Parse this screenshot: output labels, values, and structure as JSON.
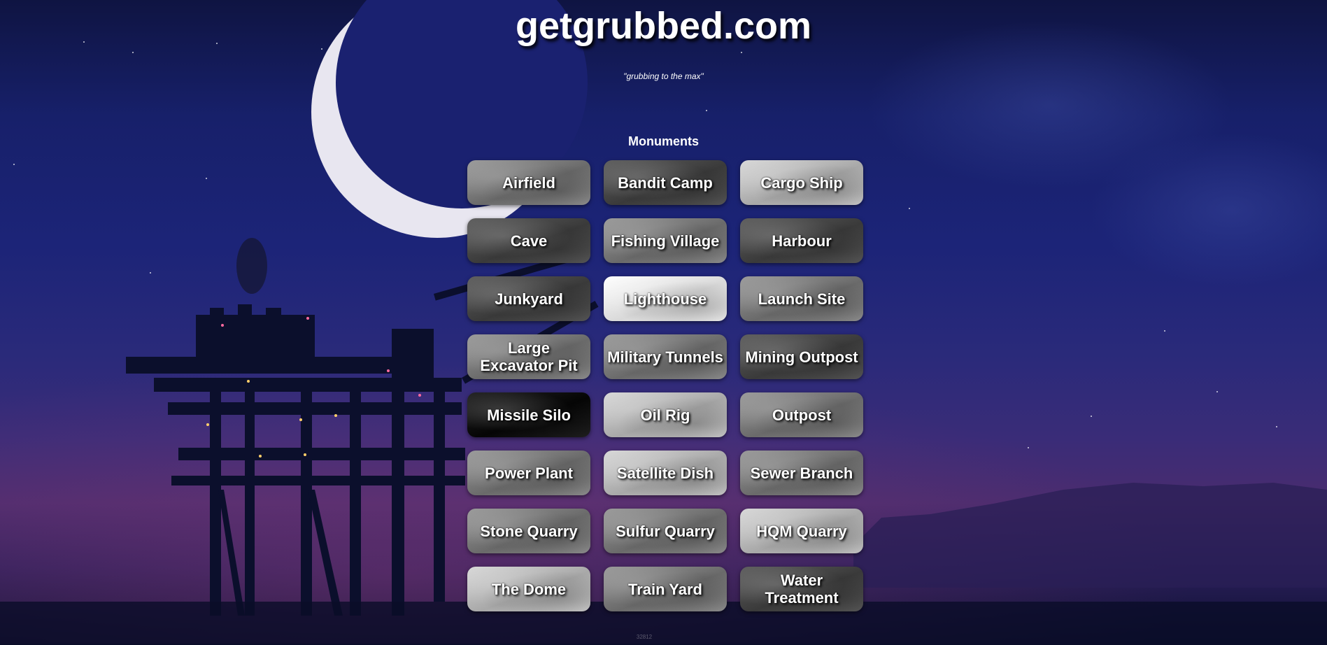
{
  "header": {
    "site_title": "getgrubbed.com",
    "tagline": "\"grubbing to the max\""
  },
  "section": {
    "title": "Monuments"
  },
  "monuments": [
    {
      "label": "Airfield",
      "tone": "mid"
    },
    {
      "label": "Bandit Camp",
      "tone": "dark"
    },
    {
      "label": "Cargo Ship",
      "tone": "light"
    },
    {
      "label": "Cave",
      "tone": "dark"
    },
    {
      "label": "Fishing Village",
      "tone": "mid"
    },
    {
      "label": "Harbour",
      "tone": "dark"
    },
    {
      "label": "Junkyard",
      "tone": "dark"
    },
    {
      "label": "Lighthouse",
      "tone": "bright"
    },
    {
      "label": "Launch Site",
      "tone": "mid"
    },
    {
      "label": "Large Excavator Pit",
      "tone": "mid"
    },
    {
      "label": "Military Tunnels",
      "tone": "mid"
    },
    {
      "label": "Mining Outpost",
      "tone": "dark"
    },
    {
      "label": "Missile Silo",
      "tone": "black"
    },
    {
      "label": "Oil Rig",
      "tone": "light"
    },
    {
      "label": "Outpost",
      "tone": "mid"
    },
    {
      "label": "Power Plant",
      "tone": "mid"
    },
    {
      "label": "Satellite Dish",
      "tone": "light"
    },
    {
      "label": "Sewer Branch",
      "tone": "mid"
    },
    {
      "label": "Stone Quarry",
      "tone": "mid"
    },
    {
      "label": "Sulfur Quarry",
      "tone": "mid"
    },
    {
      "label": "HQM Quarry",
      "tone": "light"
    },
    {
      "label": "The Dome",
      "tone": "light"
    },
    {
      "label": "Train Yard",
      "tone": "mid"
    },
    {
      "label": "Water Treatment",
      "tone": "dark"
    }
  ],
  "footer": {
    "counter": "32812"
  },
  "colors": {
    "sky_top": "#0f1442",
    "sky_mid": "#1c2478",
    "horizon": "#4a2c6e",
    "moon": "#e8e6f0",
    "text": "#ffffff"
  }
}
